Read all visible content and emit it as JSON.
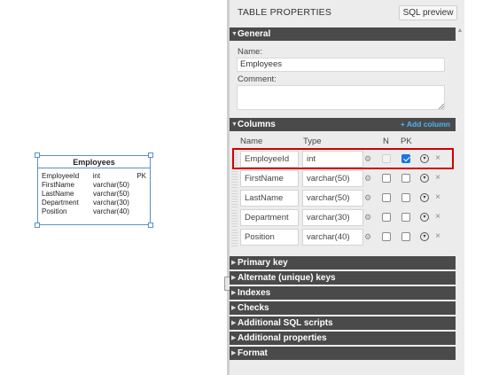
{
  "entity": {
    "title": "Employees",
    "rows": [
      {
        "name": "EmployeeId",
        "type": "int",
        "key": "PK"
      },
      {
        "name": "FirstName",
        "type": "varchar(50)",
        "key": ""
      },
      {
        "name": "LastName",
        "type": "varchar(50)",
        "key": ""
      },
      {
        "name": "Department",
        "type": "varchar(30)",
        "key": ""
      },
      {
        "name": "Position",
        "type": "varchar(40)",
        "key": ""
      }
    ]
  },
  "panel": {
    "title": "TABLE PROPERTIES",
    "sql_preview": "SQL preview",
    "general": {
      "header": "General",
      "name_label": "Name:",
      "name_value": "Employees",
      "comment_label": "Comment:",
      "comment_value": ""
    },
    "columns": {
      "header": "Columns",
      "add_label": "+ Add column",
      "headers": {
        "name": "Name",
        "type": "Type",
        "n": "N",
        "pk": "PK"
      },
      "rows": [
        {
          "name": "EmployeeId",
          "type": "int",
          "nullable": false,
          "pk": true,
          "nullable_disabled": true
        },
        {
          "name": "FirstName",
          "type": "varchar(50)",
          "nullable": false,
          "pk": false,
          "nullable_disabled": false
        },
        {
          "name": "LastName",
          "type": "varchar(50)",
          "nullable": false,
          "pk": false,
          "nullable_disabled": false
        },
        {
          "name": "Department",
          "type": "varchar(30)",
          "nullable": false,
          "pk": false,
          "nullable_disabled": false
        },
        {
          "name": "Position",
          "type": "varchar(40)",
          "nullable": false,
          "pk": false,
          "nullable_disabled": false
        }
      ]
    },
    "sections": [
      {
        "label": "Primary key"
      },
      {
        "label": "Alternate (unique) keys"
      },
      {
        "label": "Indexes"
      },
      {
        "label": "Checks"
      },
      {
        "label": "Additional SQL scripts"
      },
      {
        "label": "Additional properties"
      },
      {
        "label": "Format"
      }
    ]
  },
  "icons": {
    "expanded": "triangle-down",
    "collapsed": "triangle-right",
    "column_settings": "gear-icon",
    "row_menu": "circle-chevron-icon",
    "row_delete": "close-icon"
  },
  "colors": {
    "section_header": "#4a4a4a",
    "accent_link": "#4fb3f0",
    "selection_border": "#5b8fc8",
    "highlight": "#d00000",
    "checkbox_checked": "#1a73e8"
  }
}
